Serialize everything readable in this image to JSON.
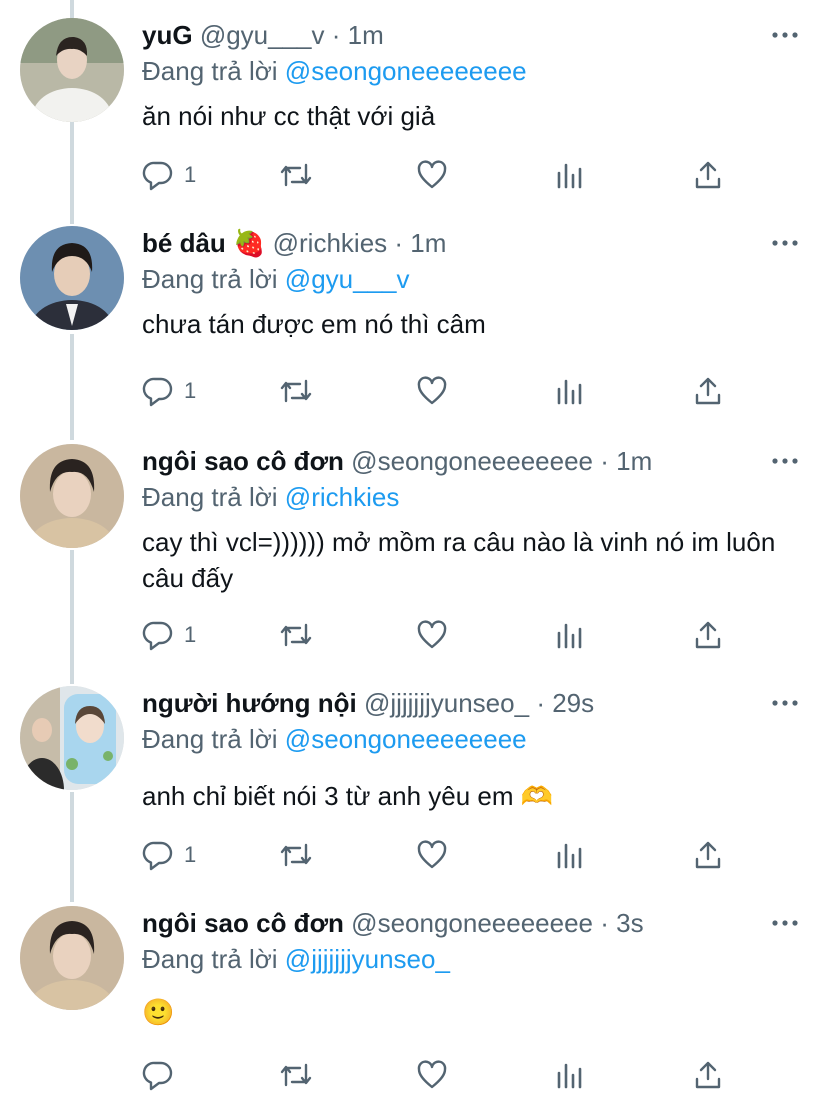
{
  "reply_prefix": "Đang trả lời",
  "tweets": [
    {
      "name": "yuG",
      "handle": "@gyu___v",
      "time": "1m",
      "replying_to": "@seongoneeeeeeee",
      "text": "ăn nói như cc thật với giả",
      "reply_count": "1"
    },
    {
      "name": "bé dâu 🍓",
      "handle": "@richkies",
      "time": "1m",
      "replying_to": "@gyu___v",
      "text": "chưa tán được em nó thì câm",
      "reply_count": "1"
    },
    {
      "name": "ngôi sao cô đơn",
      "handle": "@seongoneeeeeeee",
      "time": "1m",
      "replying_to": "@richkies",
      "text": "cay thì vcl=)))))) mở mồm ra câu nào là vinh nó im luôn câu đấy",
      "reply_count": "1"
    },
    {
      "name": "người hướng nội",
      "handle": "@jjjjjjjyunseo_",
      "time": "29s",
      "replying_to": "@seongoneeeeeeee",
      "text": "anh chỉ biết nói 3 từ anh yêu em 🫶",
      "reply_count": "1"
    },
    {
      "name": "ngôi sao cô đơn",
      "handle": "@seongoneeeeeeee",
      "time": "3s",
      "replying_to": "@jjjjjjjyunseo_",
      "text": "🙂",
      "reply_count": ""
    }
  ],
  "colors": {
    "text": "#0f1419",
    "muted": "#536471",
    "link": "#1d9bf0",
    "thread_line": "#cfd9de"
  },
  "icons": [
    "reply-icon",
    "retweet-icon",
    "like-icon",
    "analytics-icon",
    "share-icon",
    "more-icon"
  ]
}
